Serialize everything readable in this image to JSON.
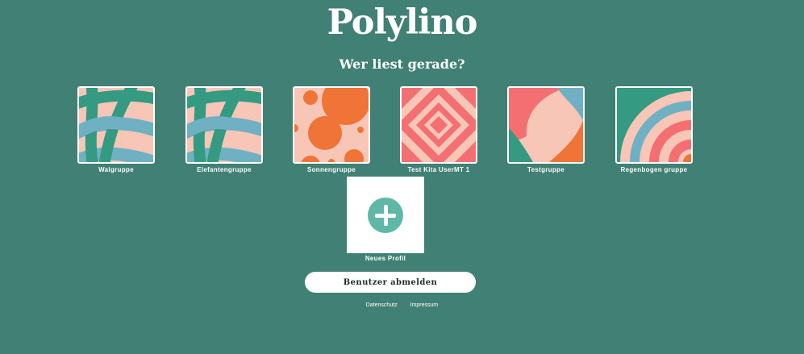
{
  "app": {
    "logo": "Polylino",
    "subtitle": "Wer liest gerade?"
  },
  "profiles": [
    {
      "name": "Walgruppe",
      "pattern": "weave"
    },
    {
      "name": "Elefantengruppe",
      "pattern": "weave"
    },
    {
      "name": "Sonnengruppe",
      "pattern": "dots"
    },
    {
      "name": "Test Kita UserMT 1",
      "pattern": "diamonds"
    },
    {
      "name": "Testgruppe",
      "pattern": "swirl"
    },
    {
      "name": "Regenbogen gruppe",
      "pattern": "rainbow"
    }
  ],
  "new_profile": {
    "label": "Neues Profil",
    "icon": "plus-icon"
  },
  "logout_button": "Benutzer abmelden",
  "footer": {
    "privacy": "Datenschutz",
    "imprint": "Impressum"
  },
  "colors": {
    "background": "#418074",
    "peach": "#f8c6b6",
    "green": "#349a82",
    "blue": "#6fb0c2",
    "orange": "#f07437",
    "coral": "#f36f72",
    "accent": "#5fb8a6"
  }
}
